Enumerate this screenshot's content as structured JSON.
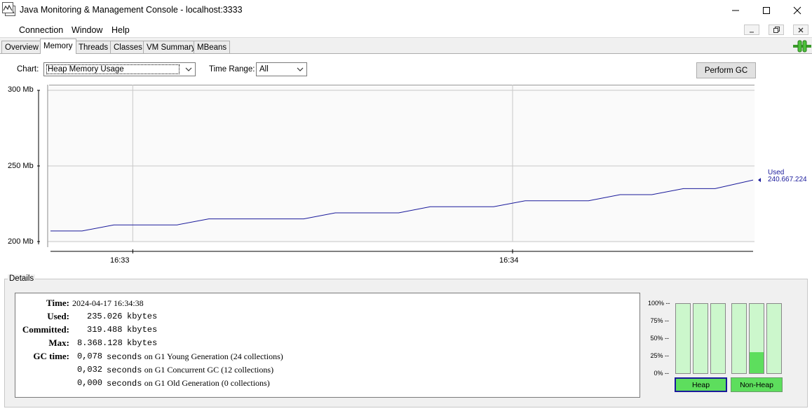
{
  "window": {
    "title": "Java Monitoring & Management Console - localhost:3333"
  },
  "menu": {
    "items": [
      "Connection",
      "Window",
      "Help"
    ]
  },
  "tabs": [
    {
      "label": "Overview",
      "active": false
    },
    {
      "label": "Memory",
      "active": true
    },
    {
      "label": "Threads",
      "active": false
    },
    {
      "label": "Classes",
      "active": false
    },
    {
      "label": "VM Summary",
      "active": false
    },
    {
      "label": "MBeans",
      "active": false
    }
  ],
  "controls": {
    "chart_label": "Chart:",
    "chart_value": "Heap Memory Usage",
    "range_label": "Time Range:",
    "range_value": "All",
    "perform_gc": "Perform GC"
  },
  "chart_data": {
    "type": "line",
    "ylim": [
      200,
      300
    ],
    "yticks": [
      {
        "value": 300,
        "label": "300 Mb"
      },
      {
        "value": 250,
        "label": "250 Mb"
      },
      {
        "value": 200,
        "label": "200 Mb"
      }
    ],
    "xticks": [
      "16:33",
      "16:34"
    ],
    "series": [
      {
        "name": "Used",
        "color": "#1a1a9b",
        "current_value": "240.667.224",
        "x": [
          "16:32:47",
          "16:32:52",
          "16:32:57",
          "16:33:02",
          "16:33:07",
          "16:33:12",
          "16:33:17",
          "16:33:22",
          "16:33:27",
          "16:33:32",
          "16:33:37",
          "16:33:42",
          "16:33:47",
          "16:33:52",
          "16:33:57",
          "16:34:02",
          "16:34:07",
          "16:34:12",
          "16:34:17",
          "16:34:22",
          "16:34:27",
          "16:34:32",
          "16:34:38"
        ],
        "values": [
          207,
          207,
          211,
          211,
          211,
          215,
          215,
          215,
          215,
          219,
          219,
          219,
          223,
          223,
          223,
          227,
          227,
          227,
          231,
          231,
          235,
          235,
          240.7
        ]
      }
    ]
  },
  "details": {
    "title": "Details",
    "time_label": "Time:",
    "time_value": "2024-04-17 16:34:38",
    "used_label": "Used:",
    "used_value": "235.026",
    "committed_label": "Committed:",
    "committed_value": "319.488",
    "max_label": "Max:",
    "max_value": "8.368.128",
    "unit": "kbytes",
    "gc_label": "GC time:",
    "gc_rows": [
      {
        "seconds": "0,078",
        "text": "seconds on G1 Young Generation (24 collections)"
      },
      {
        "seconds": "0,032",
        "text": "seconds on G1 Concurrent GC (12 collections)"
      },
      {
        "seconds": "0,000",
        "text": "seconds on G1 Old Generation (0 collections)"
      }
    ]
  },
  "pools": {
    "percent_labels": [
      "100% --",
      "75% --",
      "50% --",
      "25% --",
      "0% --"
    ],
    "heap_label": "Heap",
    "nonheap_label": "Non-Heap",
    "heap_bars": [
      0,
      0,
      0
    ],
    "nonheap_bars": [
      0,
      0.3,
      0
    ]
  }
}
